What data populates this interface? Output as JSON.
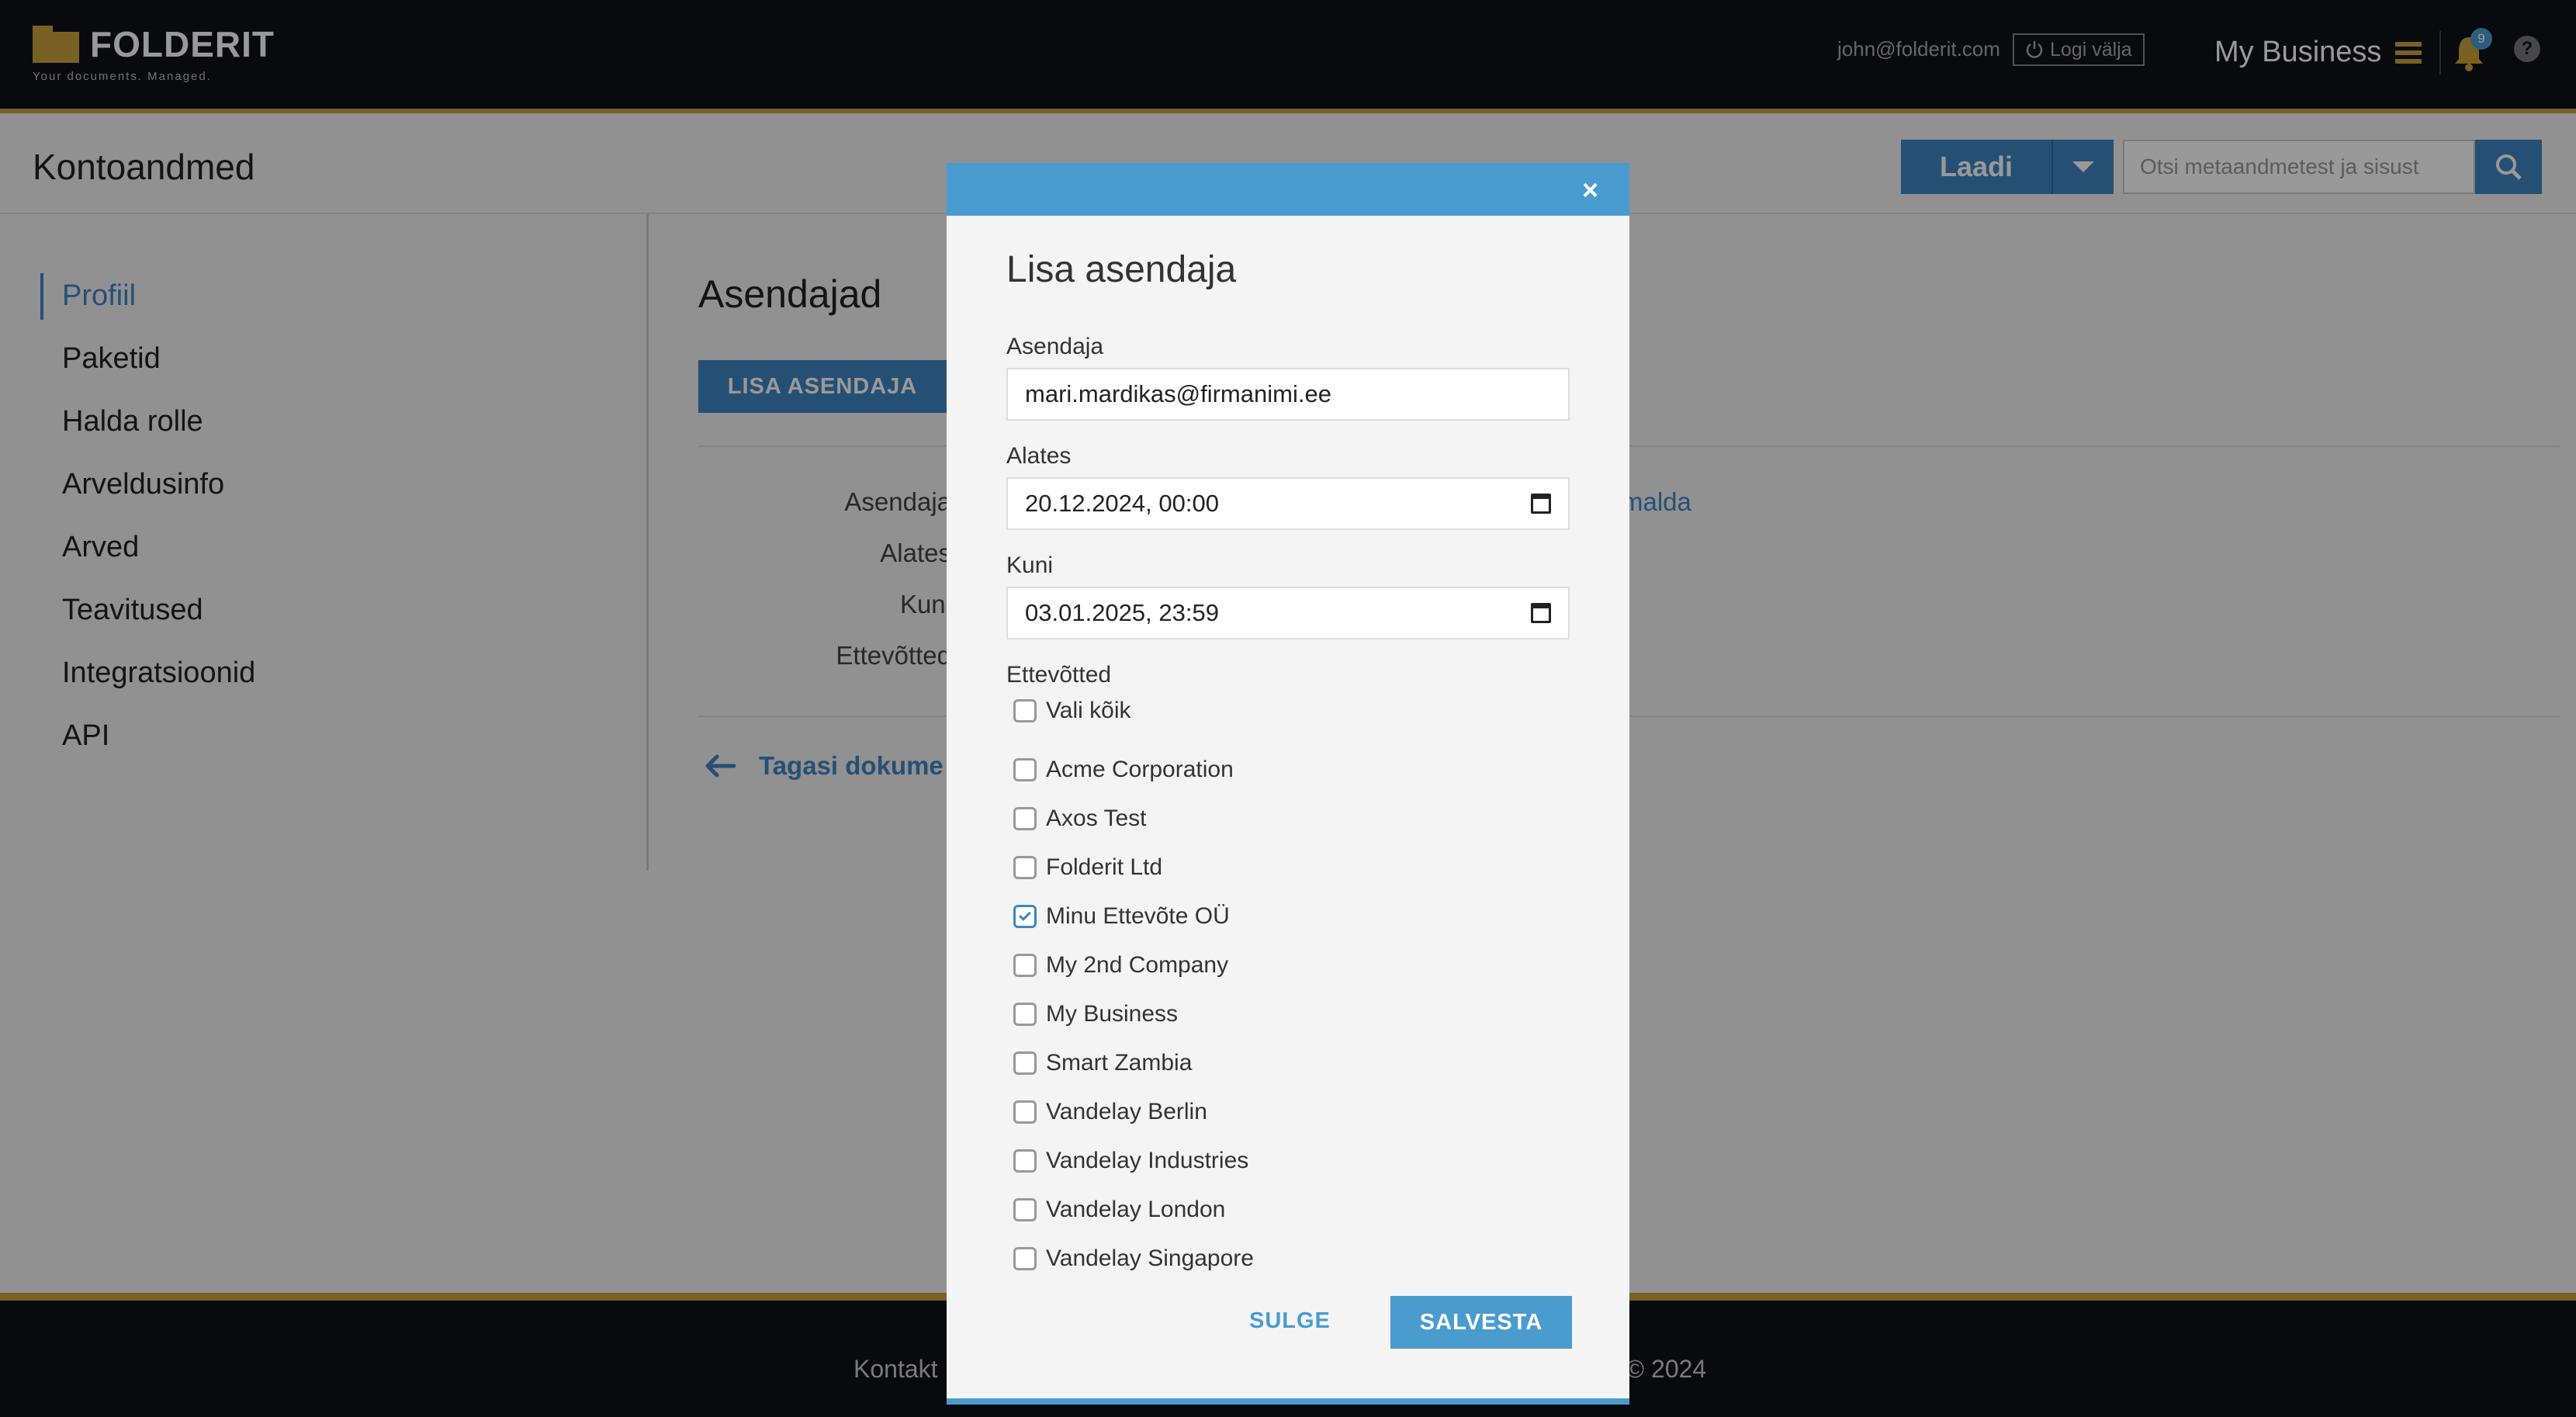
{
  "header": {
    "logo_name": "FOLDERIT",
    "logo_tagline": "Your documents. Managed.",
    "user_email": "john@folderit.com",
    "logout_label": "Logi välja",
    "business_name": "My Business",
    "notification_count": "9",
    "help_label": "?"
  },
  "subheader": {
    "title": "Kontoandmed",
    "upload_label": "Laadi",
    "search_placeholder": "Otsi metaandmetest ja sisust"
  },
  "sidebar": {
    "items": [
      {
        "label": "Profiil",
        "active": true
      },
      {
        "label": "Paketid"
      },
      {
        "label": "Halda rolle"
      },
      {
        "label": "Arveldusinfo"
      },
      {
        "label": "Arved"
      },
      {
        "label": "Teavitused"
      },
      {
        "label": "Integratsioonid"
      },
      {
        "label": "API"
      }
    ]
  },
  "content": {
    "title": "Asendajad",
    "add_button": "LISA ASENDAJA",
    "field_labels": [
      "Asendaja",
      "Alates",
      "Kuni",
      "Ettevõtted"
    ],
    "cancel_link_partial": "malda",
    "back_link": "Tagasi dokume"
  },
  "footer": {
    "contact_partial": "Kontakt",
    "copyright_partial": "rit © 2024"
  },
  "modal": {
    "close": "×",
    "title": "Lisa asendaja",
    "substitute_label": "Asendaja",
    "substitute_value": "mari.mardikas@firmanimi.ee",
    "from_label": "Alates",
    "from_value": "20.12.2024, 00:00",
    "to_label": "Kuni",
    "to_value": "03.01.2025, 23:59",
    "companies_label": "Ettevõtted",
    "select_all_label": "Vali kõik",
    "companies": [
      {
        "name": "Acme Corporation",
        "checked": false
      },
      {
        "name": "Axos Test",
        "checked": false
      },
      {
        "name": "Folderit Ltd",
        "checked": false
      },
      {
        "name": "Minu Ettevõte OÜ",
        "checked": true
      },
      {
        "name": "My 2nd Company",
        "checked": false
      },
      {
        "name": "My Business",
        "checked": false
      },
      {
        "name": "Smart Zambia",
        "checked": false
      },
      {
        "name": "Vandelay Berlin",
        "checked": false
      },
      {
        "name": "Vandelay Industries",
        "checked": false
      },
      {
        "name": "Vandelay London",
        "checked": false
      },
      {
        "name": "Vandelay Singapore",
        "checked": false
      }
    ],
    "close_button": "SULGE",
    "save_button": "SALVESTA"
  },
  "colors": {
    "accent": "#3f86c2",
    "modal_accent": "#4a9ccf",
    "brand_gold": "#c9a23a",
    "header_bg": "#0e1116"
  }
}
